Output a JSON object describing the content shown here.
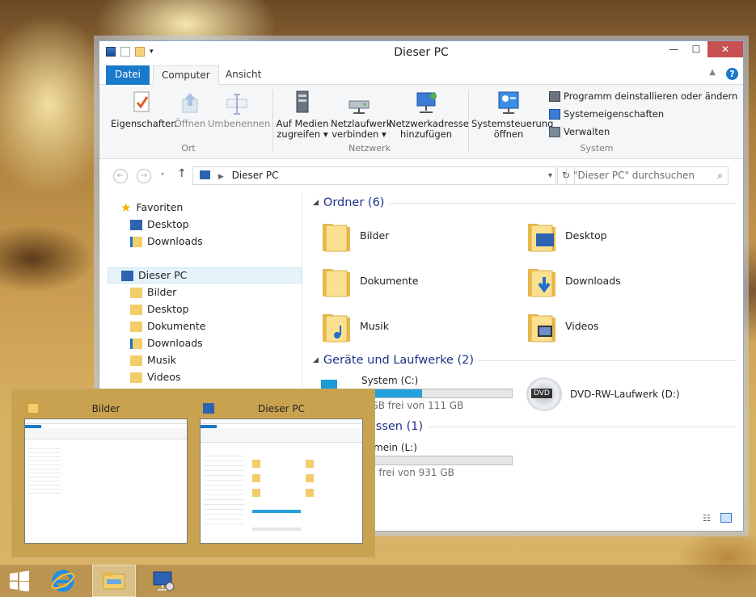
{
  "window": {
    "title": "Dieser PC",
    "controls": {
      "minimize": "—",
      "maximize": "☐",
      "close": "✕"
    }
  },
  "ribbon": {
    "tabs": [
      "Datei",
      "Computer",
      "Ansicht"
    ],
    "groups": {
      "ort": {
        "label": "Ort",
        "buttons": [
          "Eigenschaften",
          "Öffnen",
          "Umbenennen"
        ]
      },
      "netzwerk": {
        "label": "Netzwerk",
        "buttons": [
          {
            "line1": "Auf Medien",
            "line2": "zugreifen ▾"
          },
          {
            "line1": "Netzlaufwerk",
            "line2": "verbinden ▾"
          },
          {
            "line1": "Netzwerkadresse",
            "line2": "hinzufügen"
          }
        ]
      },
      "system": {
        "label": "System",
        "button": {
          "line1": "Systemsteuerung",
          "line2": "öffnen"
        },
        "links": [
          "Programm deinstallieren oder ändern",
          "Systemeigenschaften",
          "Verwalten"
        ]
      }
    }
  },
  "address": {
    "path": "Dieser PC",
    "search_placeholder": "\"Dieser PC\" durchsuchen"
  },
  "nav": {
    "favorites": {
      "label": "Favoriten",
      "items": [
        "Desktop",
        "Downloads"
      ]
    },
    "this_pc": {
      "label": "Dieser PC",
      "items": [
        "Bilder",
        "Desktop",
        "Dokumente",
        "Downloads",
        "Musik",
        "Videos"
      ]
    }
  },
  "content": {
    "folders_header": "Ordner (6)",
    "folders": [
      "Bilder",
      "Desktop",
      "Dokumente",
      "Downloads",
      "Musik",
      "Videos"
    ],
    "devices_header": "Geräte und Laufwerke (2)",
    "drives": [
      {
        "name": "System (C:)",
        "free_text": "2 GB frei von 111 GB",
        "used_fraction": 0.4
      },
      {
        "name": "DVD-RW-Laufwerk (D:)"
      }
    ],
    "network_header": "dressen (1)",
    "network_drive": {
      "name": "gemein (L:)",
      "free_text": "GB frei von 931 GB",
      "used_fraction": 0.06
    }
  },
  "preview": {
    "windows": [
      "Bilder",
      "Dieser PC"
    ]
  },
  "taskbar": {
    "items": [
      "start-icon",
      "internet-explorer-icon",
      "file-explorer-icon",
      "remote-desktop-icon"
    ]
  }
}
